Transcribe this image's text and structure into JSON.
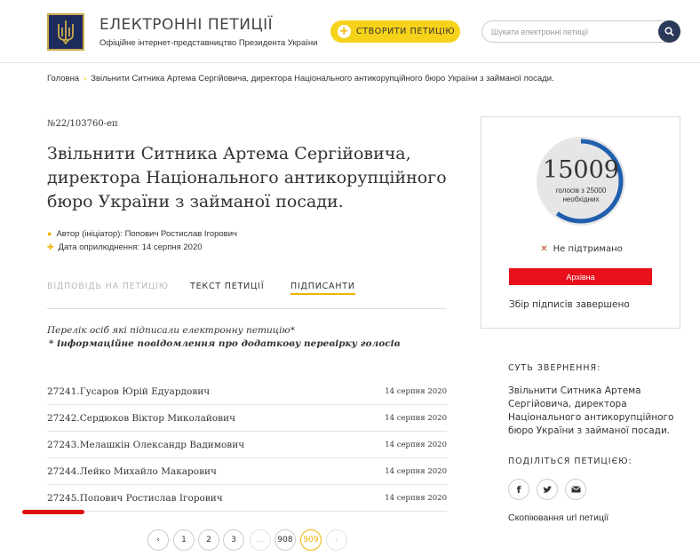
{
  "header": {
    "site_title": "ЕЛЕКТРОННІ ПЕТИЦІЇ",
    "site_subtitle": "Офіційне інтернет-представництво Президента України",
    "create_button": "СТВОРИТИ ПЕТИЦІЮ",
    "search_placeholder": "Шукати електронні петиції"
  },
  "breadcrumb": {
    "home": "Головна",
    "current": "Звільнити Ситника Артема Сергійовича, директора Національного антикорупційного бюро України з займаної посади."
  },
  "petition": {
    "number": "№22/103760-еп",
    "title": "Звільнити Ситника Артема Сергійовича, директора Національного антикорупційного бюро України з займаної посади.",
    "author": "Автор (ініціатор): Попович Ростислав Ігорович",
    "published": "Дата оприлюднення: 14 серпня 2020"
  },
  "tabs": [
    {
      "label": "ВІДПОВІДЬ НА ПЕТИЦІЮ",
      "state": "inactive"
    },
    {
      "label": "ТЕКСТ ПЕТИЦІЇ",
      "state": "normal"
    },
    {
      "label": "ПІДПИСАНТИ",
      "state": "active"
    }
  ],
  "signers_section": {
    "intro": "Перелік осіб які підписали електронну петицію*",
    "note": "* інформаційне повідомлення про додаткову перевірку голосів"
  },
  "signers": [
    {
      "num": "27241.Гусаров Юрій Едуардович",
      "date": "14 серпня 2020"
    },
    {
      "num": "27242.Сердюков Віктор Миколайович",
      "date": "14 серпня 2020"
    },
    {
      "num": "27243.Мелашкін Олександр Вадимович",
      "date": "14 серпня 2020"
    },
    {
      "num": "27244.Лейко Михайло Макарович",
      "date": "14 серпня 2020"
    },
    {
      "num": "27245.Попович Ростислав Ігорович",
      "date": "14 серпня 2020"
    }
  ],
  "pagination": {
    "prev": "‹",
    "pages": [
      "1",
      "2",
      "3",
      "…",
      "908",
      "909"
    ],
    "current": "909",
    "next": "›"
  },
  "votes": {
    "count": "15009",
    "label_line1": "голосів з 25000",
    "label_line2": "необхідних",
    "progress_fraction": 0.6,
    "status": "Не підтримано",
    "archive_label": "Архівна",
    "closed_text": "Збір підписів завершено"
  },
  "sidebar": {
    "essence_heading": "СУТЬ ЗВЕРНЕННЯ:",
    "essence_text": "Звільнити Ситника Артема Сергійовича, директора Національного антикорупційного бюро України з займаної посади.",
    "share_heading": "ПОДІЛІТЬСЯ ПЕТИЦІЄЮ:",
    "share_icons": [
      "facebook-icon",
      "twitter-icon",
      "email-icon"
    ],
    "copy_url": "Скопіювання url петиції"
  },
  "colors": {
    "accent_yellow": "#f7d21a",
    "gauge_blue": "#1f5fae",
    "archive_red": "#e8101a",
    "header_navy": "#1c2a5c"
  }
}
